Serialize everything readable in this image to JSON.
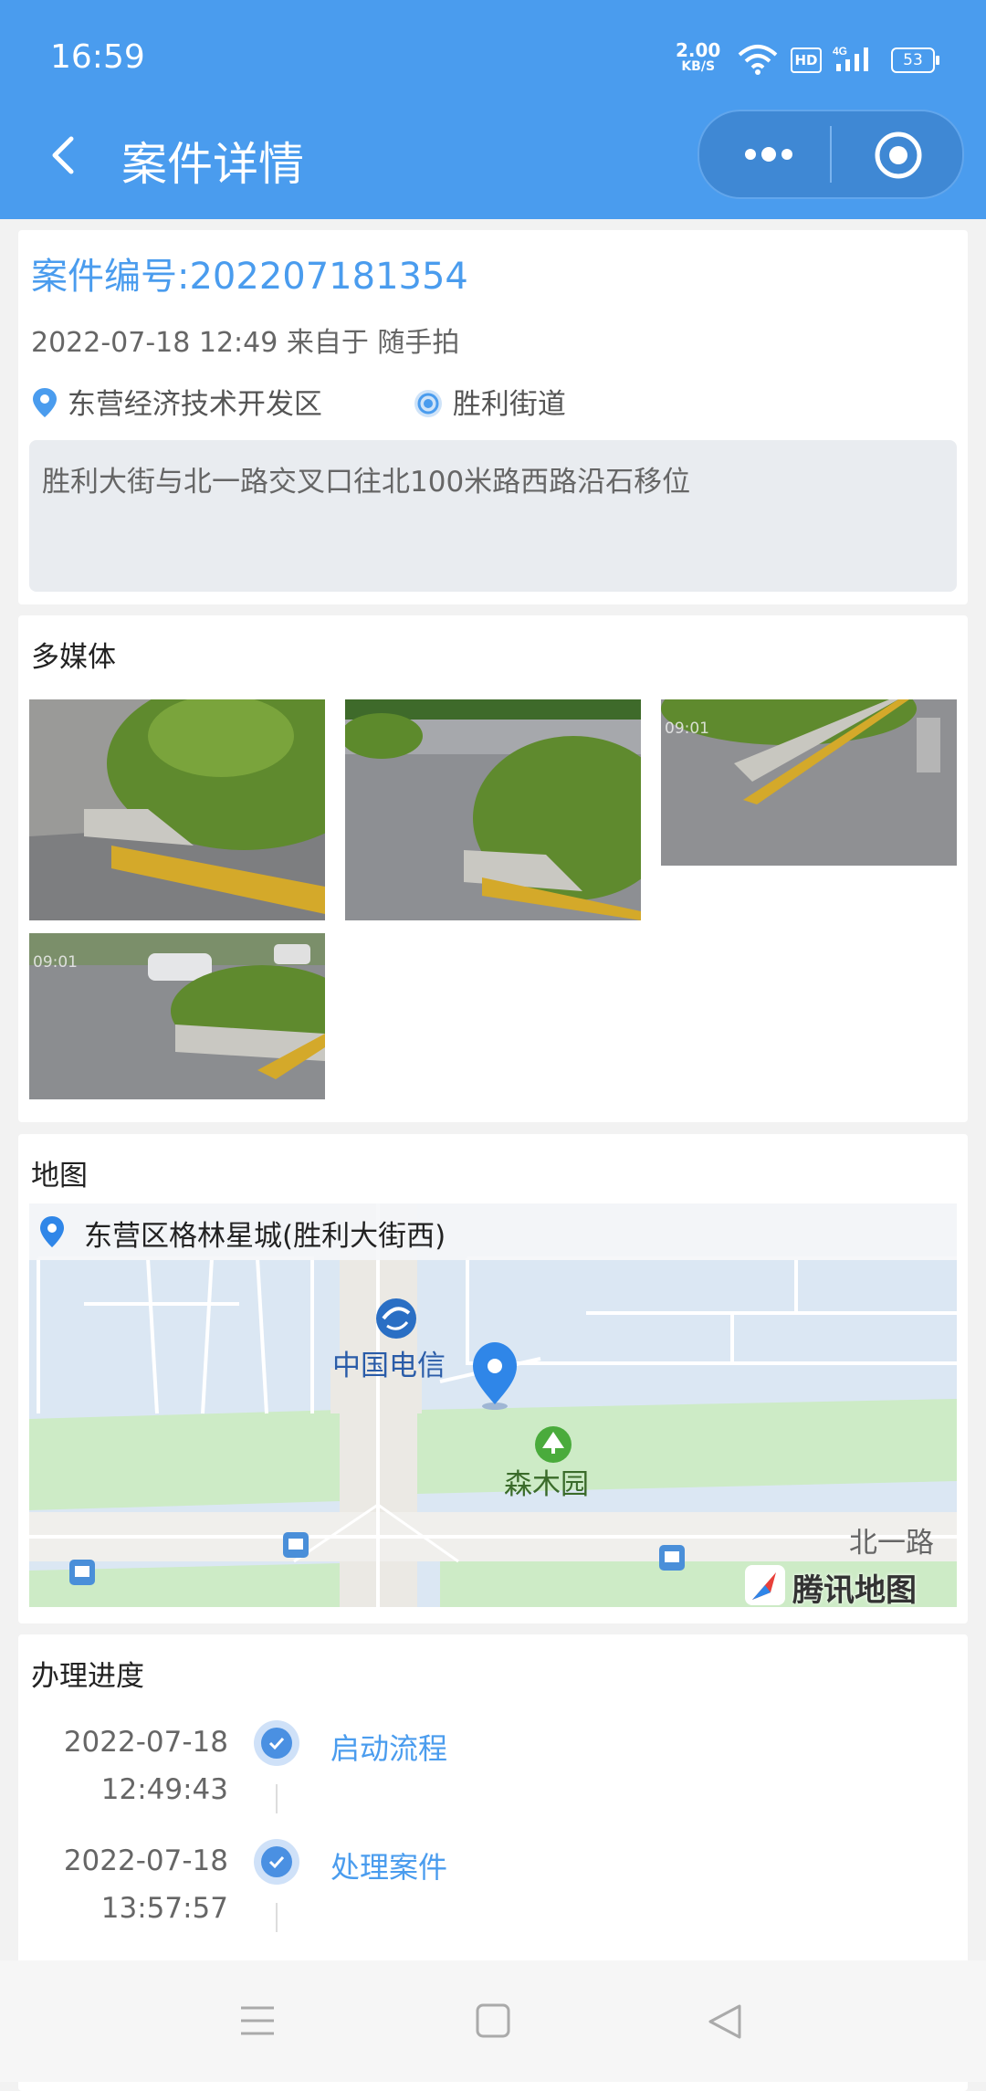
{
  "status_bar": {
    "time": "16:59",
    "net_speed_value": "2.00",
    "net_speed_unit": "KB/S",
    "hd": "HD",
    "network": "4G",
    "battery": "53"
  },
  "nav": {
    "title": "案件详情"
  },
  "case": {
    "number": "案件编号:202207181354",
    "meta": "2022-07-18 12:49 来自于 随手拍",
    "district": "东营经济技术开发区",
    "street": "胜利街道",
    "description": "胜利大街与北一路交叉口往北100米路西路沿石移位"
  },
  "media": {
    "title": "多媒体",
    "photos": [
      {
        "timestamp": ""
      },
      {
        "timestamp": ""
      },
      {
        "timestamp": "09:01"
      },
      {
        "timestamp": "09:01"
      }
    ]
  },
  "map_section": {
    "title": "地图",
    "address": "东营区格林星城(胜利大街西)",
    "poi_telecom": "中国电信",
    "poi_park": "森木园",
    "road": "北一路",
    "brand": "腾讯地图"
  },
  "progress": {
    "title": "办理进度",
    "steps": [
      {
        "date": "2022-07-18",
        "time": "12:49:43",
        "label": "启动流程"
      },
      {
        "date": "2022-07-18",
        "time": "13:57:57",
        "label": "处理案件"
      }
    ]
  },
  "colors": {
    "primary": "#4a9cee",
    "map_water": "#dbe7f3",
    "map_green": "#cdebc6"
  }
}
